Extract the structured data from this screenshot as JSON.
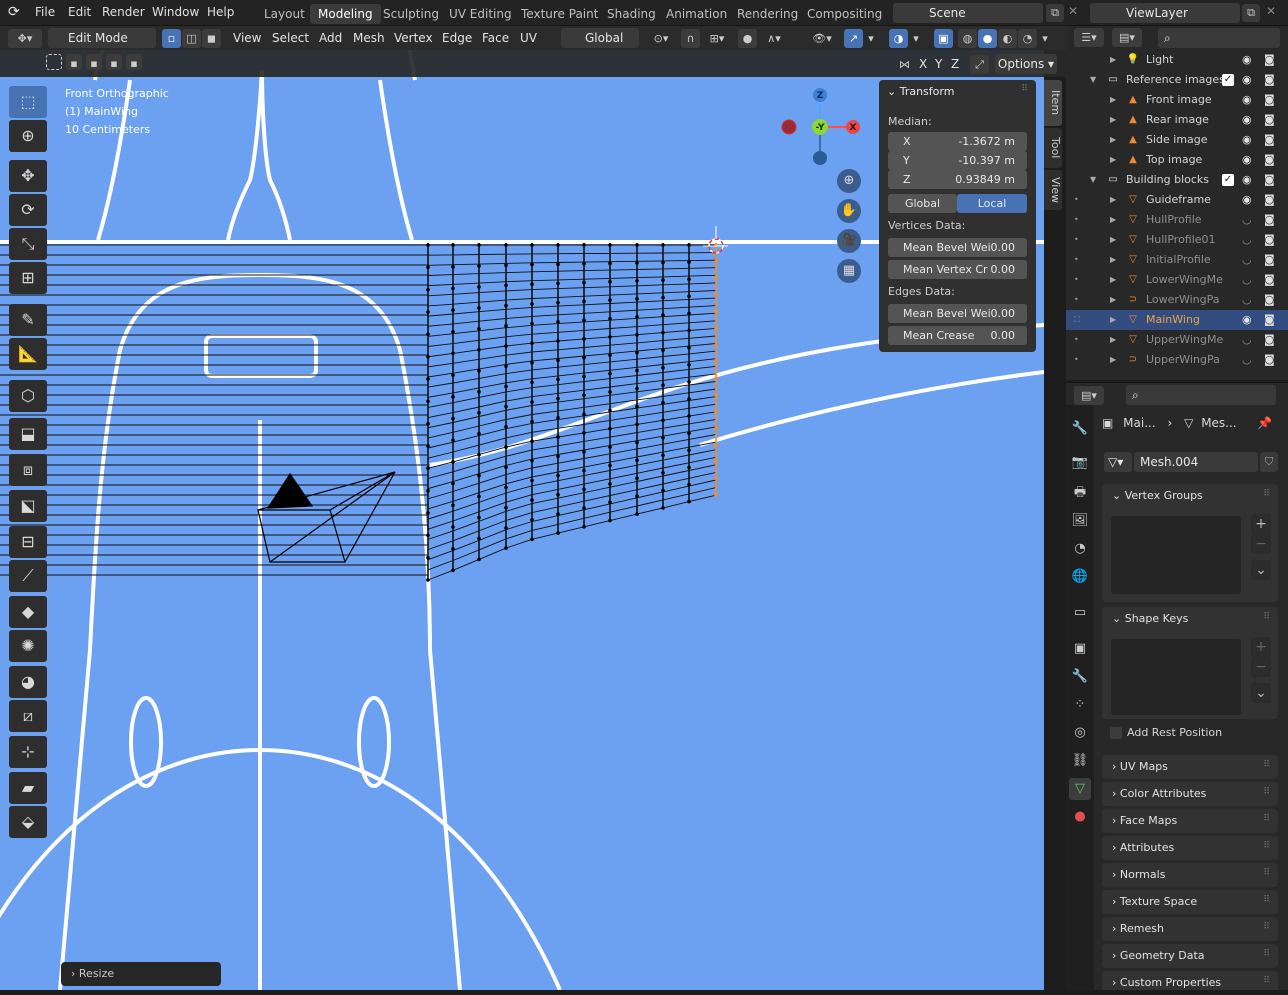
{
  "menus": [
    "File",
    "Edit",
    "Render",
    "Window",
    "Help"
  ],
  "workspaces": [
    "Layout",
    "Modeling",
    "Sculpting",
    "UV Editing",
    "Texture Paint",
    "Shading",
    "Animation",
    "Rendering",
    "Compositing"
  ],
  "active_workspace": "Modeling",
  "scene": "Scene",
  "view_layer": "ViewLayer",
  "header": {
    "mode": "Edit Mode",
    "view": "View",
    "select": "Select",
    "add": "Add",
    "mesh": "Mesh",
    "vertex": "Vertex",
    "edge": "Edge",
    "face": "Face",
    "uv": "UV",
    "orientation": "Global"
  },
  "viewport": {
    "view_name": "Front Orthographic",
    "object": "(1) MainWing",
    "scale": "10 Centimeters",
    "options": "Options",
    "axes": [
      "X",
      "Y",
      "Z"
    ]
  },
  "gizmo": {
    "z": "Z",
    "y": "-Y",
    "x": "X"
  },
  "transform": {
    "title": "Transform",
    "median": "Median:",
    "x_label": "X",
    "x": "-1.3672 m",
    "y_label": "Y",
    "y": "-10.397 m",
    "z_label": "Z",
    "z": "0.93849 m",
    "global": "Global",
    "local": "Local",
    "vertices_data": "Vertices Data:",
    "mean_bevel_weight": "Mean Bevel Wei",
    "mean_bevel_weight_val": "0.00",
    "mean_vertex_crease": "Mean Vertex Cr",
    "mean_vertex_crease_val": "0.00",
    "edges_data": "Edges Data:",
    "edge_bevel": "Mean Bevel Wei",
    "edge_bevel_val": "0.00",
    "mean_crease": "Mean Crease",
    "mean_crease_val": "0.00"
  },
  "side_tabs": [
    "Item",
    "Tool",
    "View"
  ],
  "outliner": [
    {
      "name": "Light",
      "indent": 2,
      "icon": "light"
    },
    {
      "name": "Reference images",
      "indent": 1,
      "icon": "collection",
      "checked": true
    },
    {
      "name": "Front image",
      "indent": 2,
      "icon": "image"
    },
    {
      "name": "Rear image",
      "indent": 2,
      "icon": "image"
    },
    {
      "name": "Side image",
      "indent": 2,
      "icon": "image"
    },
    {
      "name": "Top image",
      "indent": 2,
      "icon": "image"
    },
    {
      "name": "Building blocks",
      "indent": 1,
      "icon": "collection",
      "checked": true
    },
    {
      "name": "Guideframe",
      "indent": 2,
      "icon": "mesh"
    },
    {
      "name": "HullProfile",
      "indent": 2,
      "icon": "mesh",
      "dim": true
    },
    {
      "name": "HullProfile01",
      "indent": 2,
      "icon": "mesh",
      "dim": true
    },
    {
      "name": "InitialProfile",
      "indent": 2,
      "icon": "mesh",
      "dim": true
    },
    {
      "name": "LowerWingMe",
      "indent": 2,
      "icon": "mesh",
      "dim": true
    },
    {
      "name": "LowerWingPa",
      "indent": 2,
      "icon": "curve",
      "dim": true
    },
    {
      "name": "MainWing",
      "indent": 2,
      "icon": "mesh",
      "selected": true
    },
    {
      "name": "UpperWingMe",
      "indent": 2,
      "icon": "mesh",
      "dim": true
    },
    {
      "name": "UpperWingPa",
      "indent": 2,
      "icon": "curve",
      "dim": true
    }
  ],
  "props": {
    "breadcrumb_obj": "Mai...",
    "breadcrumb_mesh": "Mes...",
    "mesh_name": "Mesh.004",
    "panels": [
      "Vertex Groups",
      "Shape Keys",
      "UV Maps",
      "Color Attributes",
      "Face Maps",
      "Attributes",
      "Normals",
      "Texture Space",
      "Remesh",
      "Geometry Data",
      "Custom Properties"
    ],
    "add_rest_position": "Add Rest Position"
  },
  "resize": "Resize"
}
